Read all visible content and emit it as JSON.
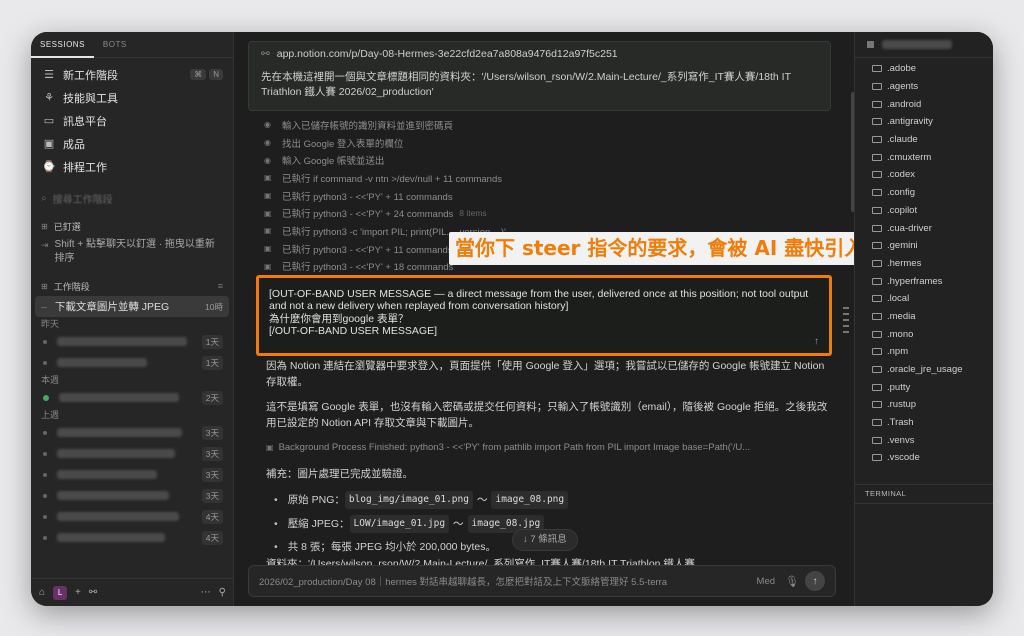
{
  "sidebar": {
    "tabs": [
      "SESSIONS",
      "BOTS"
    ],
    "nav": [
      {
        "icon": "new-session-icon",
        "glyph": "☰",
        "label": "新工作階段",
        "kbd": [
          "⌘",
          "N"
        ]
      },
      {
        "icon": "skills-icon",
        "glyph": "⚘",
        "label": "技能與工具"
      },
      {
        "icon": "message-icon",
        "glyph": "▭",
        "label": "訊息平台"
      },
      {
        "icon": "product-icon",
        "glyph": "▣",
        "label": "成品"
      },
      {
        "icon": "schedule-icon",
        "glyph": "⌚",
        "label": "排程工作"
      }
    ],
    "search_placeholder": "搜尋工作階段",
    "pinned": {
      "title": "已釘選",
      "hint": "Shift + 點擊聊天以釘選 · 拖曳以重新排序"
    },
    "sessions": {
      "title": "工作階段",
      "active": {
        "label": "下載文章圖片並轉 JPEG",
        "badge": "10時"
      },
      "groups": [
        {
          "label": "昨天",
          "items": [
            {
              "w": 130,
              "badge": "1天"
            },
            {
              "w": 90,
              "badge": "1天"
            }
          ]
        },
        {
          "label": "本週",
          "items": [
            {
              "w": 120,
              "badge": "2天",
              "green": true
            }
          ]
        },
        {
          "label": "上週",
          "items": [
            {
              "w": 125,
              "badge": "3天"
            },
            {
              "w": 118,
              "badge": "3天"
            },
            {
              "w": 100,
              "badge": "3天"
            },
            {
              "w": 112,
              "badge": "3天"
            },
            {
              "w": 122,
              "badge": "4天"
            },
            {
              "w": 108,
              "badge": "4天"
            }
          ]
        }
      ]
    },
    "bottom_badge": "L"
  },
  "main": {
    "url": "app.notion.com/p/Day-08-Hermes-3e22cfd2ea7a808a9476d12a97f5c251",
    "user_msg": "先在本機這裡開一個與文章標題相同的資料夾：'/Users/wilson_rson/W/2.Main-Lecture/_系列寫作_IT賽人賽/18th IT Triathlon 鐵人賽 2026/02_production'",
    "steps": [
      {
        "icon": "globe-icon",
        "glyph": "◉",
        "text": "輸入已儲存帳號的識別資料並進到密碼頁"
      },
      {
        "icon": "globe-icon",
        "glyph": "◉",
        "text": "找出 Google 登入表單的欄位"
      },
      {
        "icon": "globe-icon",
        "glyph": "◉",
        "text": "輸入 Google 帳號並送出"
      },
      {
        "icon": "terminal-icon",
        "glyph": "▣",
        "text": "已執行 if command -v ntn >/dev/null + 11 commands"
      },
      {
        "icon": "terminal-icon",
        "glyph": "▣",
        "text": "已執行 python3 - <<'PY' + 11 commands"
      },
      {
        "icon": "terminal-icon",
        "glyph": "▣",
        "text": "已執行 python3 - <<'PY' + 24 commands",
        "extra": "8 items"
      },
      {
        "icon": "terminal-icon",
        "glyph": "▣",
        "text": "已執行 python3 -c 'import PIL; print(PIL.__version__)'"
      },
      {
        "icon": "terminal-icon",
        "glyph": "▣",
        "text": "已執行 python3 - <<'PY' + 11 commands"
      },
      {
        "icon": "terminal-icon",
        "glyph": "▣",
        "text": "已執行 python3 - <<'PY' + 18 commands"
      }
    ],
    "callout": "當你下 steer 指令的要求，會被 AI 盡快引入作調整",
    "oob": {
      "line1": "[OUT-OF-BAND USER MESSAGE — a direct message from the user, delivered once at this position; not tool output and not a new delivery when replayed from conversation history]",
      "line2": "為什麼你會用到google 表單？",
      "line3": "[/OUT-OF-BAND USER MESSAGE]"
    },
    "reply": {
      "p1": "因為 Notion 連結在瀏覽器中要求登入，頁面提供「使用 Google 登入」選項；我嘗試以已儲存的 Google 帳號建立 Notion 存取權。",
      "p2": "這不是填寫 Google 表單，也沒有輸入密碼或提交任何資料；只輸入了帳號識別（email），隨後被 Google 拒絕。之後我改用已設定的 Notion API 存取文章與下載圖片。",
      "bg": "Background Process Finished: python3 - <<'PY' from pathlib import Path from PIL import Image base=Path('/U...",
      "supplement": "補充：圖片處理已完成並驗證。",
      "b1_pre": "原始 PNG：",
      "b1_a": "blog_img/image_01.png",
      "b1_sep": "～",
      "b1_b": "image_08.png",
      "b2_pre": "壓縮 JPEG：",
      "b2_a": "LOW/image_01.jpg",
      "b2_sep": "～",
      "b2_b": "image_08.jpg",
      "b3": "共 8 張；每張 JPEG 均小於 200,000 bytes。",
      "source": "資料夾：'/Users/wilson_rson/W/2.Main-Lecture/_系列寫作_IT賽人賽/18th IT Triathlon 鐵人賽"
    },
    "more_pill": "↓ 7 條訊息",
    "composer": {
      "placeholder": "2026/02_production/Day 08｜hermes 對話串越聊越長，怎麼把對話及上下文脈絡管理好 5.5-terra",
      "model": "Med"
    }
  },
  "right": {
    "folders": [
      ".adobe",
      ".agents",
      ".android",
      ".antigravity",
      ".claude",
      ".cmuxterm",
      ".codex",
      ".config",
      ".copilot",
      ".cua-driver",
      ".gemini",
      ".hermes",
      ".hyperframes",
      ".local",
      ".media",
      ".mono",
      ".npm",
      ".oracle_jre_usage",
      ".putty",
      ".rustup",
      ".Trash",
      ".venvs",
      ".vscode"
    ],
    "terminal": "TERMINAL"
  }
}
